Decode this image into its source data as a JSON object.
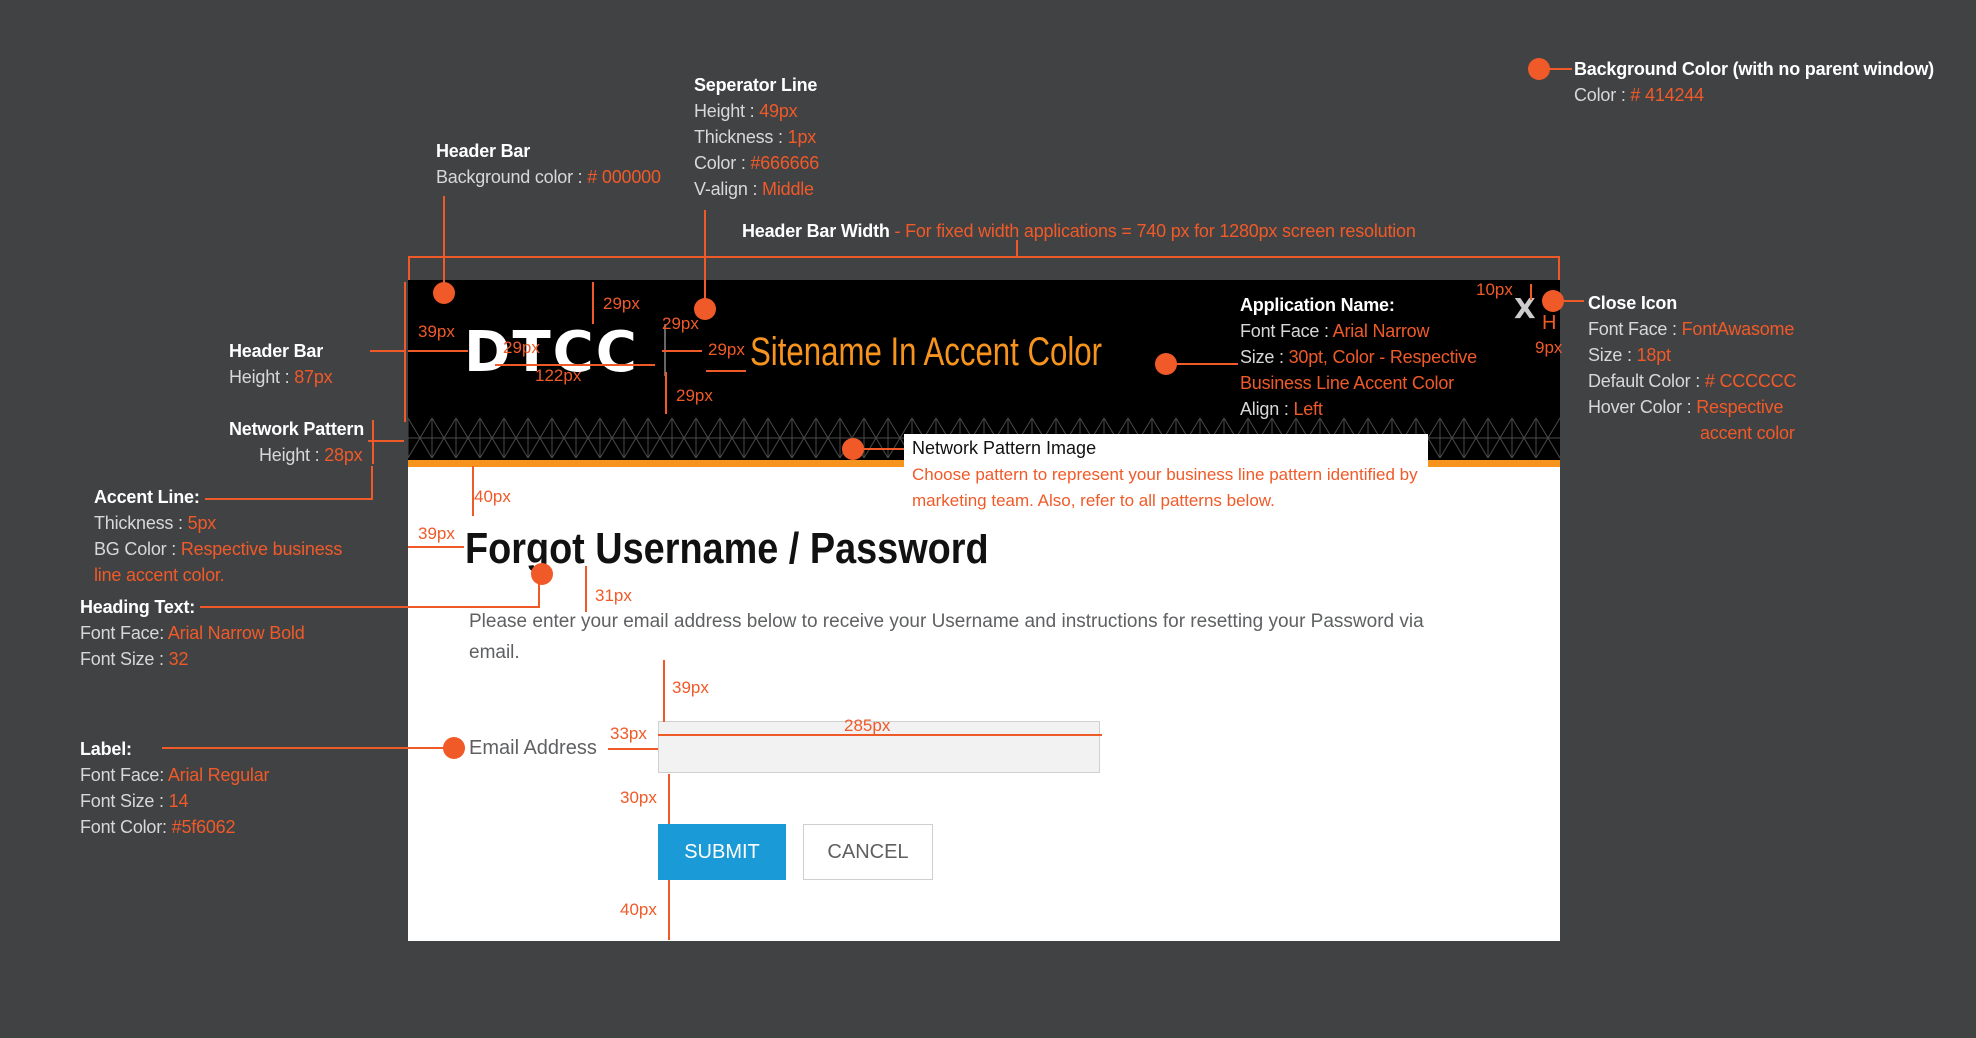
{
  "annotations": {
    "background": {
      "title": "Background Color (with no parent window)",
      "key": "Color : ",
      "value": "# 414244"
    },
    "separator": {
      "title": "Seperator Line",
      "rows": [
        {
          "k": "Height : ",
          "v": "49px"
        },
        {
          "k": "Thickness : ",
          "v": "1px"
        },
        {
          "k": "Color : ",
          "v": "#666666"
        },
        {
          "k": "V-align : ",
          "v": "Middle"
        }
      ]
    },
    "header_bg": {
      "title": "Header Bar",
      "key": "Background color : ",
      "value": "# 000000"
    },
    "header_width": {
      "key": "Header Bar Width",
      "value": " - For fixed width applications = 740 px for 1280px screen resolution"
    },
    "header_height": {
      "title": "Header Bar",
      "key": "Height : ",
      "value": "87px"
    },
    "network_pattern": {
      "title": "Network Pattern",
      "key": "Height : ",
      "value": "28px"
    },
    "accent_line": {
      "title": "Accent Line:",
      "rows": [
        {
          "k": "Thickness : ",
          "v": "5px"
        },
        {
          "k": "BG Color : ",
          "v": "Respective business"
        },
        {
          "k": "",
          "v": "line accent color."
        }
      ]
    },
    "heading_text": {
      "title": "Heading Text:",
      "rows": [
        {
          "k": "Font Face: ",
          "v": "Arial Narrow Bold"
        },
        {
          "k": "Font Size : ",
          "v": "32"
        }
      ]
    },
    "label": {
      "title": "Label:",
      "rows": [
        {
          "k": "Font Face: ",
          "v": "Arial Regular"
        },
        {
          "k": "Font Size : ",
          "v": "14"
        },
        {
          "k": "Font Color: ",
          "v": "#5f6062"
        }
      ]
    },
    "application_name": {
      "title": "Application Name:",
      "rows": [
        {
          "k": "Font Face : ",
          "v": "Arial Narrow"
        },
        {
          "k": "Size : ",
          "v": "30pt, Color - Respective"
        },
        {
          "k": "",
          "v": "Business Line Accent Color"
        },
        {
          "k": "Align : ",
          "v": "Left"
        }
      ]
    },
    "close_icon": {
      "title": "Close Icon",
      "rows": [
        {
          "k": "Font Face : ",
          "v": "FontAwasome"
        },
        {
          "k": "Size : ",
          "v": "18pt"
        },
        {
          "k": "Default Color : ",
          "v": "# CCCCCC"
        },
        {
          "k": "Hover Color : ",
          "v": "Respective"
        },
        {
          "k": "",
          "v": "accent color"
        }
      ]
    },
    "network_image": {
      "title": "Network Pattern Image",
      "desc": "Choose pattern to represent your business line pattern identified by marketing team.  Also, refer to all patterns below."
    }
  },
  "measurements": {
    "m29a": "29px",
    "m39a": "39px",
    "m29b": "29px",
    "m29c": "29px",
    "m29d": "29px",
    "m122": "122px",
    "m29e": "29px",
    "m10": "10px",
    "m9": "9px",
    "m40a": "40px",
    "m39b": "39px",
    "m31": "31px",
    "m39c": "39px",
    "m33": "33px",
    "m285": "285px",
    "m30": "30px",
    "m40b": "40px",
    "h_mark": "H"
  },
  "mock": {
    "logo": "DTCC",
    "sitename": "Sitename In Accent Color",
    "close": "X",
    "heading": "Forgot Username / Password",
    "description": "Please enter your email address below to receive your Username and instructions for resetting your Password via email.",
    "email_label": "Email Address",
    "email_value": "",
    "submit": "SUBMIT",
    "cancel": "CANCEL"
  },
  "colors": {
    "page_bg": "#414244",
    "header_bg": "#000000",
    "separator": "#666666",
    "accent": "#f7941d",
    "annotation": "#f05a28",
    "close_default": "#cccccc",
    "label": "#5f6062",
    "submit_bg": "#1a9ad6"
  }
}
